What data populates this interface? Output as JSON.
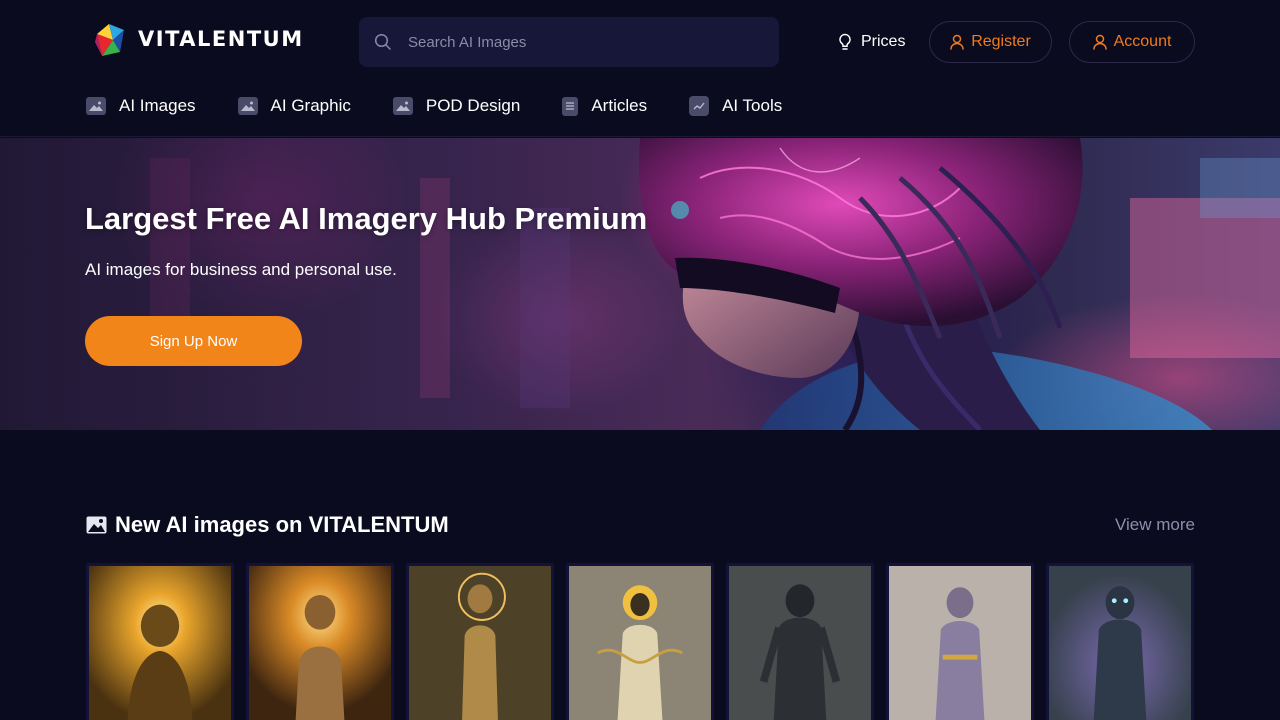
{
  "brand": {
    "name": "VITALENTUM"
  },
  "search": {
    "placeholder": "Search AI Images"
  },
  "header_links": {
    "prices": "Prices",
    "register": "Register",
    "account": "Account"
  },
  "nav": [
    {
      "label": "AI Images",
      "icon": "image-icon"
    },
    {
      "label": "AI Graphic",
      "icon": "image-icon"
    },
    {
      "label": "POD Design",
      "icon": "image-icon"
    },
    {
      "label": "Articles",
      "icon": "document-icon"
    },
    {
      "label": "AI Tools",
      "icon": "chart-icon"
    }
  ],
  "hero": {
    "title": "Largest Free AI Imagery Hub Premium",
    "subtitle": "AI images for business and personal use.",
    "cta": "Sign Up Now"
  },
  "new_images": {
    "title": "New AI images on VITALENTUM",
    "view_more": "View more",
    "thumbnails": [
      {
        "subject": "golden mummy with radiant halo",
        "bg": "#6b4a14",
        "glow": "#ffd060"
      },
      {
        "subject": "mummy figure with fiery glow",
        "bg": "#7a4a18",
        "glow": "#ffb040"
      },
      {
        "subject": "bronze mummy statue with halo",
        "bg": "#5a4a28",
        "glow": "#e8b050"
      },
      {
        "subject": "ornate golden pharaoh figure",
        "bg": "#8a8070",
        "glow": "#f0c040"
      },
      {
        "subject": "dark wrapped mummy warrior",
        "bg": "#4a4d4e",
        "glow": "#6a7580"
      },
      {
        "subject": "purple-robed mummy figure",
        "bg": "#b8b0a8",
        "glow": "#8070a0"
      },
      {
        "subject": "blue-eyed mummy with aura",
        "bg": "#3a4550",
        "glow": "#a090e0"
      }
    ]
  },
  "colors": {
    "background": "#0b0b1f",
    "accent": "#f28519",
    "search_bg": "#17173a"
  }
}
